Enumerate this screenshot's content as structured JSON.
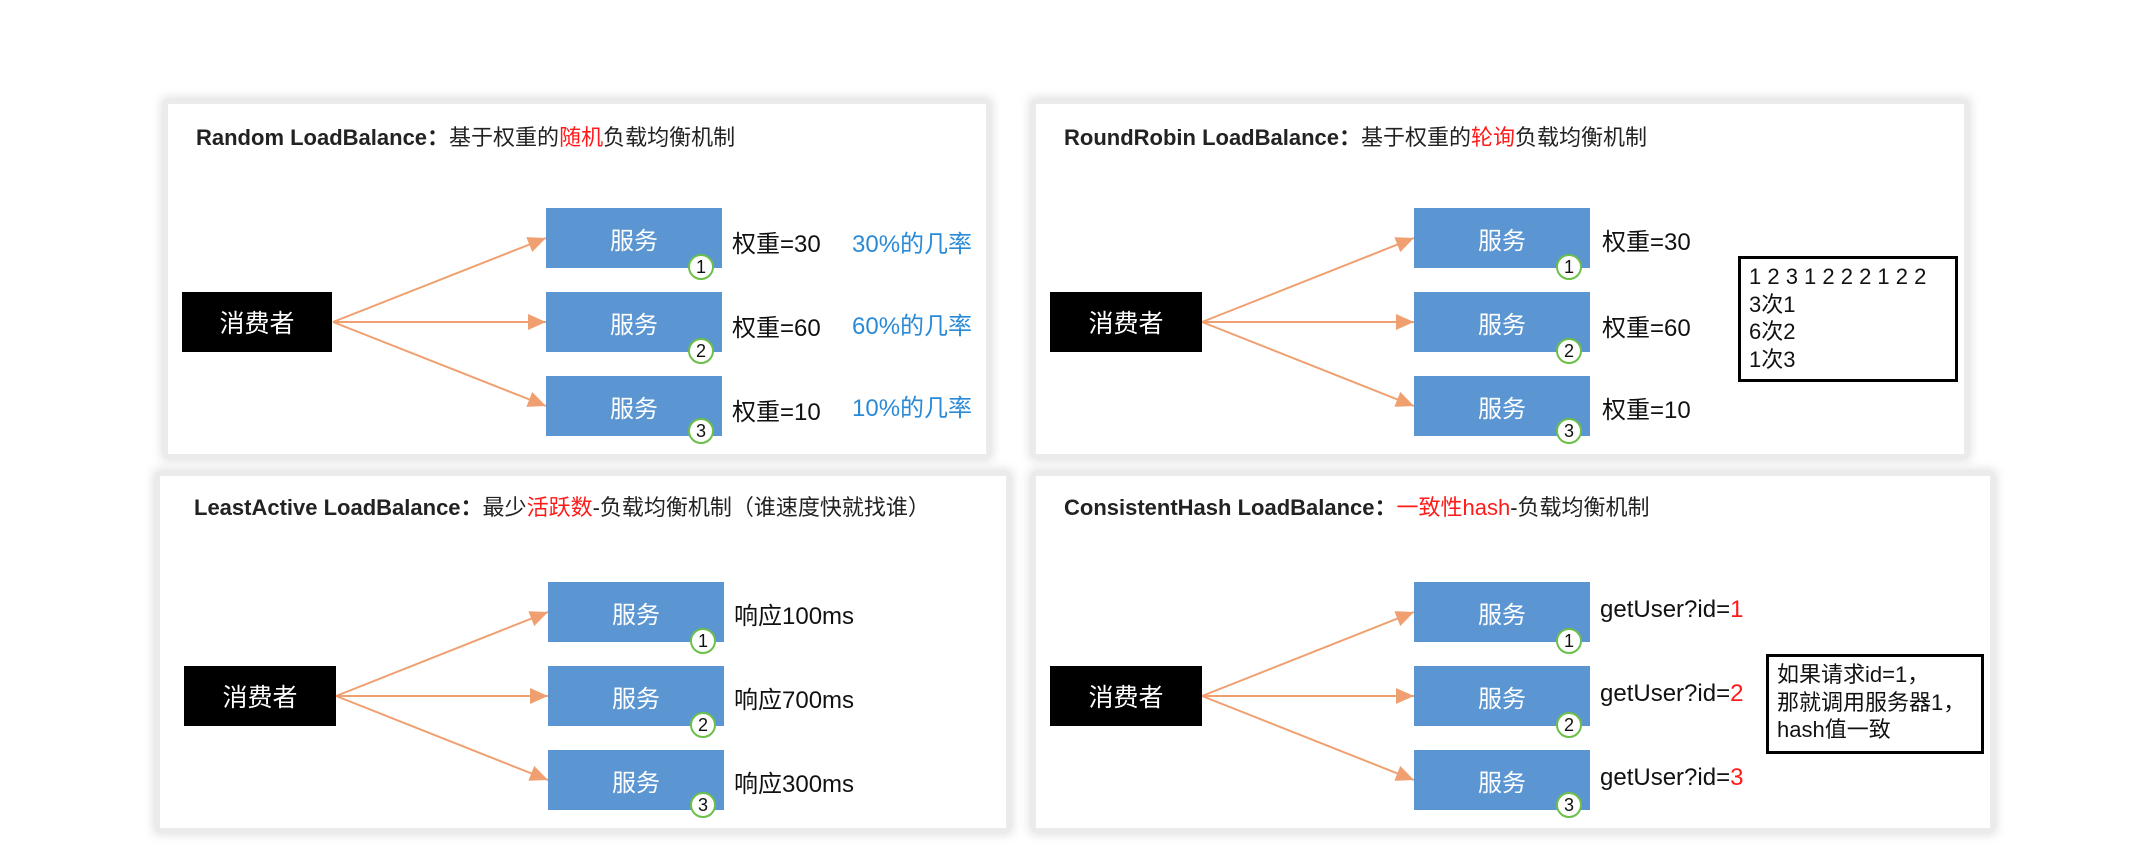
{
  "panels": [
    {
      "title_en": "Random LoadBalance：",
      "title_pre": "基于权重的",
      "title_red": "随机",
      "title_post": "负载均衡机制",
      "consumer": "消费者",
      "services": [
        {
          "label": "服务",
          "num": "1",
          "weight": "权重=30",
          "prob": "30%的几率"
        },
        {
          "label": "服务",
          "num": "2",
          "weight": "权重=60",
          "prob": "60%的几率"
        },
        {
          "label": "服务",
          "num": "3",
          "weight": "权重=10",
          "prob": "10%的几率"
        }
      ]
    },
    {
      "title_en": "RoundRobin LoadBalance：",
      "title_pre": "基于权重的",
      "title_red": "轮询",
      "title_post": "负载均衡机制",
      "consumer": "消费者",
      "services": [
        {
          "label": "服务",
          "num": "1",
          "weight": "权重=30"
        },
        {
          "label": "服务",
          "num": "2",
          "weight": "权重=60"
        },
        {
          "label": "服务",
          "num": "3",
          "weight": "权重=10"
        }
      ],
      "note": [
        "1 2 3 1 2 2 2 1 2 2",
        "3次1",
        "6次2",
        "1次3"
      ]
    },
    {
      "title_en": "LeastActive LoadBalance：",
      "title_pre": "最少",
      "title_red": "活跃数",
      "title_post": "-负载均衡机制（谁速度快就找谁）",
      "consumer": "消费者",
      "services": [
        {
          "label": "服务",
          "num": "1",
          "weight": "响应100ms"
        },
        {
          "label": "服务",
          "num": "2",
          "weight": "响应700ms"
        },
        {
          "label": "服务",
          "num": "3",
          "weight": "响应300ms"
        }
      ]
    },
    {
      "title_en": "ConsistentHash LoadBalance：",
      "title_pre": "",
      "title_red": "一致性hash",
      "title_post": "-负载均衡机制",
      "consumer": "消费者",
      "services": [
        {
          "label": "服务",
          "num": "1",
          "weight_pre": "getUser?id=",
          "weight_red": "1"
        },
        {
          "label": "服务",
          "num": "2",
          "weight_pre": "getUser?id=",
          "weight_red": "2"
        },
        {
          "label": "服务",
          "num": "3",
          "weight_pre": "getUser?id=",
          "weight_red": "3"
        }
      ],
      "note": [
        "如果请求id=1，",
        "那就调用服务器1，",
        "hash值一致"
      ]
    }
  ],
  "colors": {
    "service": "#5b96d2",
    "arrow": "#f0a070",
    "badge": "#6cc04a",
    "highlight": "#ff1a1a",
    "prob": "#2b8ad6"
  }
}
